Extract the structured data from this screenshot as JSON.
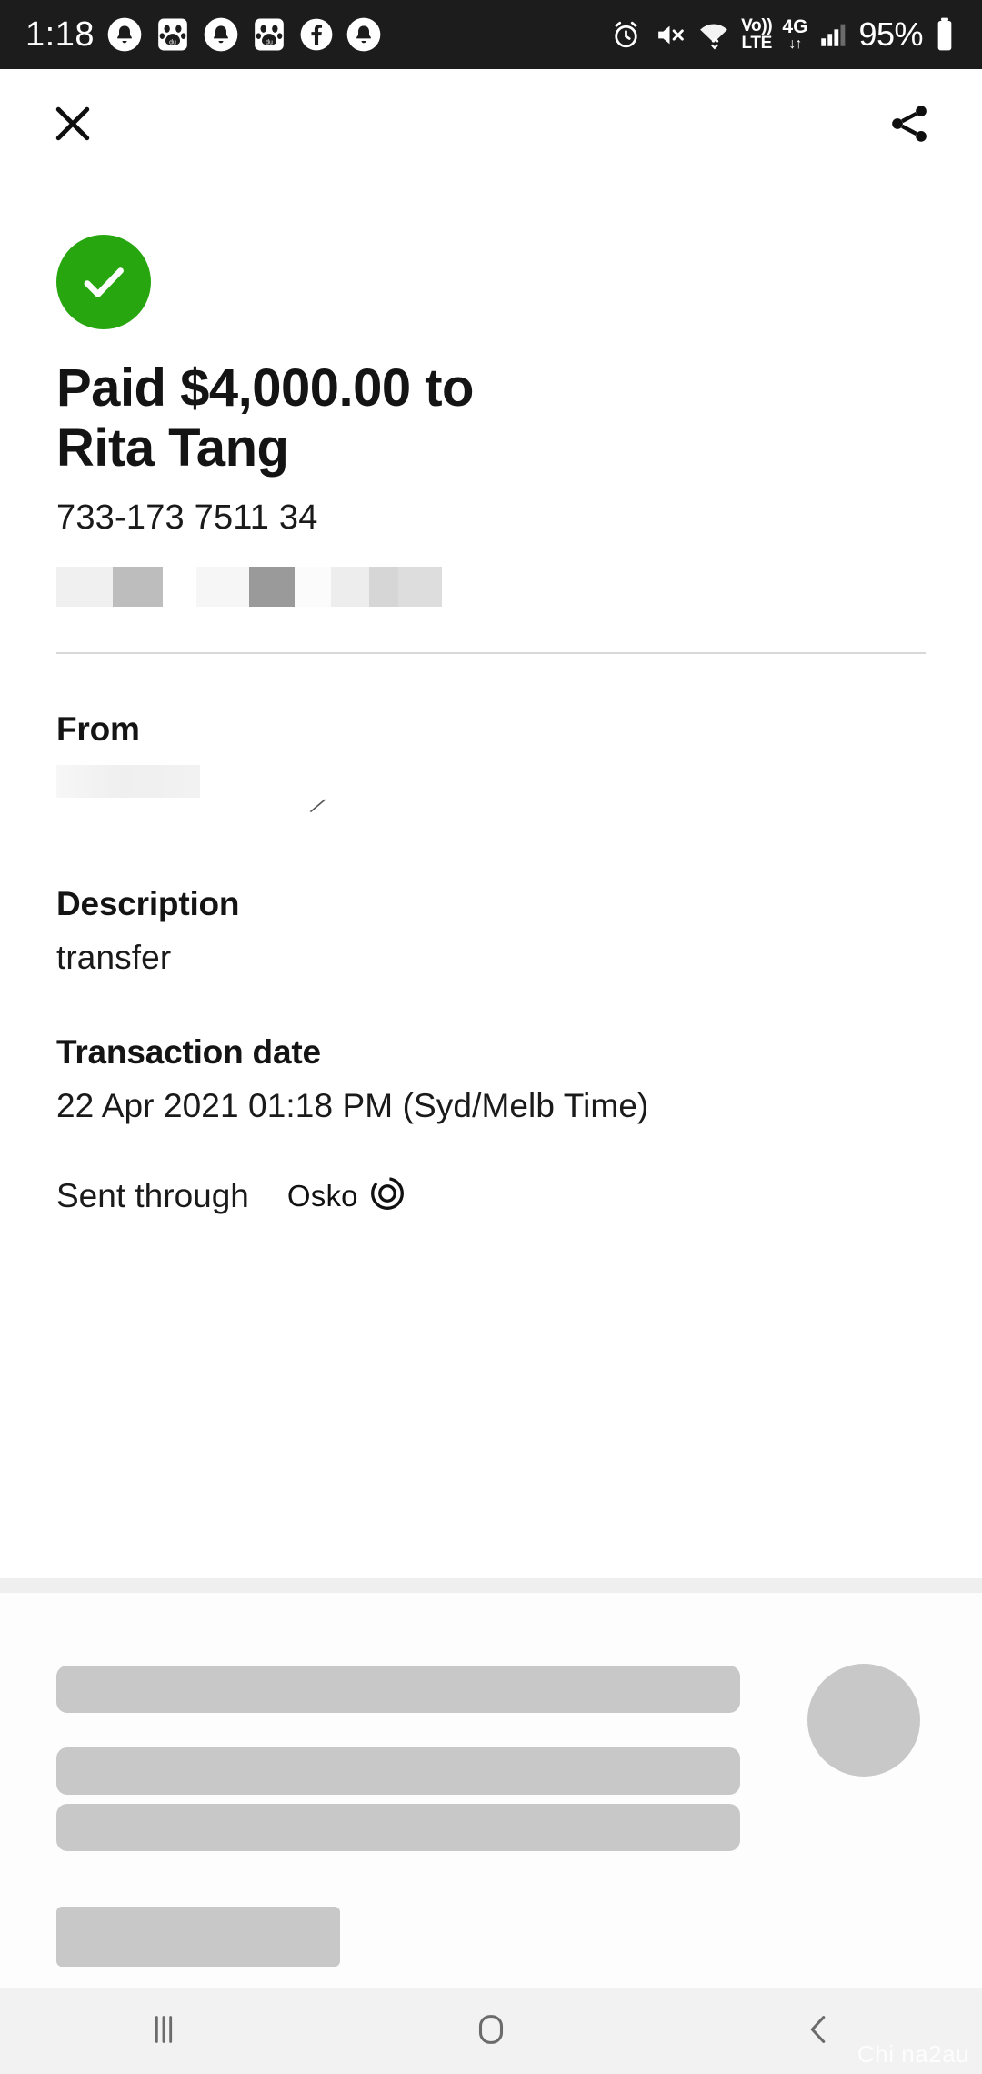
{
  "status_bar": {
    "clock": "1:18",
    "battery_percent": "95%",
    "volte_top": "Vo))",
    "volte_bottom": "LTE",
    "network": "4G",
    "network_arrows": "↓↑",
    "left_icons": [
      "notification-bell-icon",
      "baidu-app-icon",
      "notification-bell-icon",
      "baidu-app-icon",
      "facebook-icon",
      "notification-bell-icon"
    ],
    "right_icons": [
      "alarm-clock-icon",
      "volume-muted-icon",
      "wifi-icon",
      "volte-indicator",
      "mobile-data-4g-icon",
      "signal-bars-icon",
      "battery-icon"
    ]
  },
  "app_bar": {
    "close_label": "close-icon",
    "share_label": "share-icon"
  },
  "receipt": {
    "status_icon": "success-check-icon",
    "headline": "Paid $4,000.00 to Rita Tang",
    "account_number": "733-173 7511 34",
    "from_label": "From",
    "from_value": "",
    "description_label": "Description",
    "description_value": "transfer",
    "transaction_date_label": "Transaction date",
    "transaction_date_value": "22 Apr 2021 01:18 PM (Syd/Melb Time)",
    "sent_through_label": "Sent through",
    "sent_through_value": "Osko",
    "osko_icon": "osko-logo-icon"
  },
  "colors": {
    "success_green": "#27a60f",
    "status_bar_bg": "#1c1c1c",
    "text_primary": "#141414",
    "skeleton_gray": "#c8c8c8",
    "nav_bar_bg": "#f2f2f2"
  },
  "nav_bar": {
    "recents_label": "recents-icon",
    "home_label": "home-icon",
    "back_label": "back-icon"
  },
  "watermark": "Chi na2au"
}
